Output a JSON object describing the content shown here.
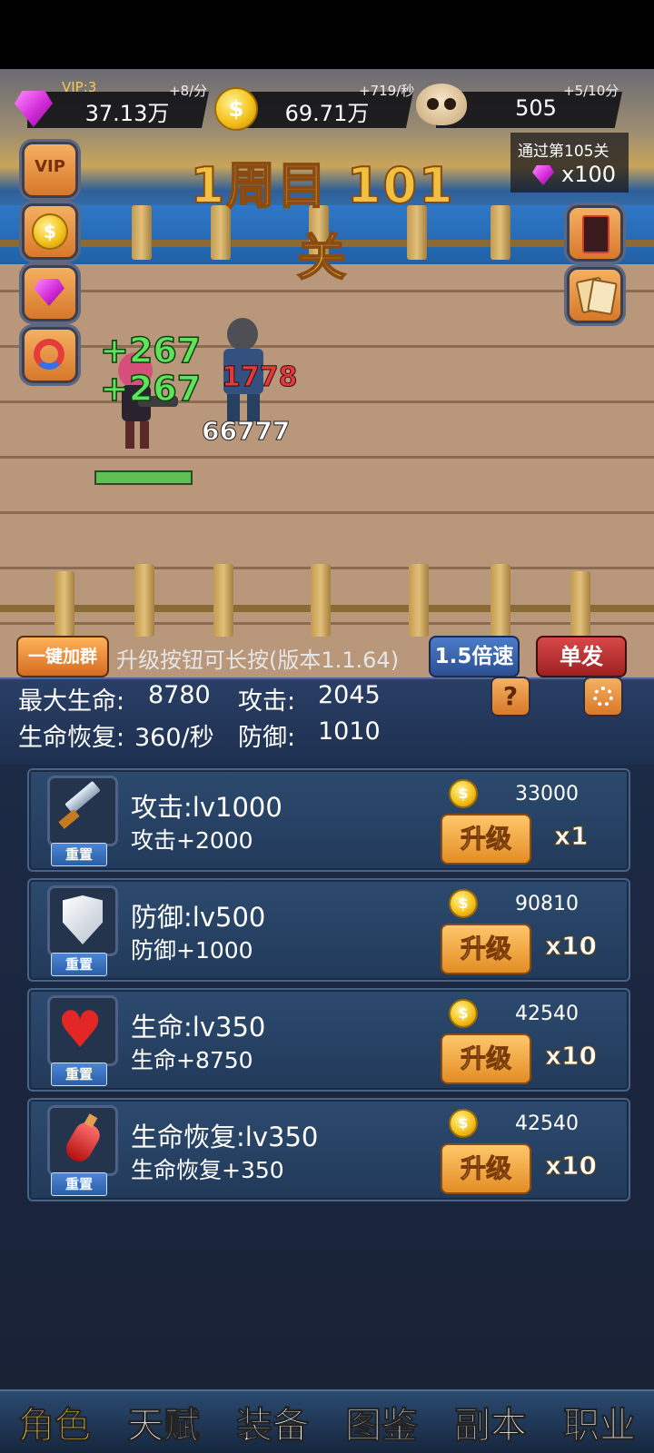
{
  "resources": {
    "gem": {
      "label": "VIP:3",
      "rate": "+8/分",
      "value": "37.13万"
    },
    "coin": {
      "rate": "+719/秒",
      "value": "69.71万"
    },
    "skull": {
      "rate": "+5/10分",
      "value": "505"
    }
  },
  "stage": {
    "title": "1周目 101关",
    "pass_label": "通过第105关",
    "pass_reward": "x100",
    "side_buttons": [
      "VIP",
      "coin",
      "gem",
      "magnet"
    ],
    "right_buttons": [
      "card-back",
      "cards"
    ],
    "heal_numbers": [
      "+267",
      "+267"
    ],
    "enemy_damage": "1778",
    "player_damage": "66777"
  },
  "action_bar": {
    "join_group": "一键加群",
    "hint": "升级按钮可长按(版本1.1.64)",
    "speed": "1.5倍速",
    "single": "单发"
  },
  "stats": {
    "max_hp_label": "最大生命:",
    "max_hp": "8780",
    "atk_label": "攻击:",
    "atk": "2045",
    "regen_label": "生命恢复:",
    "regen": "360/秒",
    "def_label": "防御:",
    "def": "1010",
    "help": "?"
  },
  "upgrades": [
    {
      "icon": "knife-icon",
      "name": "攻击:lv1000",
      "bonus": "攻击+2000",
      "price": "33000",
      "button": "升级",
      "mult": "x1",
      "reset": "重置"
    },
    {
      "icon": "shield-icon",
      "name": "防御:lv500",
      "bonus": "防御+1000",
      "price": "90810",
      "button": "升级",
      "mult": "x10",
      "reset": "重置"
    },
    {
      "icon": "heart-icon",
      "name": "生命:lv350",
      "bonus": "生命+8750",
      "price": "42540",
      "button": "升级",
      "mult": "x10",
      "reset": "重置"
    },
    {
      "icon": "potion-icon",
      "name": "生命恢复:lv350",
      "bonus": "生命恢复+350",
      "price": "42540",
      "button": "升级",
      "mult": "x10",
      "reset": "重置"
    }
  ],
  "nav": [
    "角色",
    "天赋",
    "装备",
    "图鉴",
    "副本",
    "职业"
  ]
}
